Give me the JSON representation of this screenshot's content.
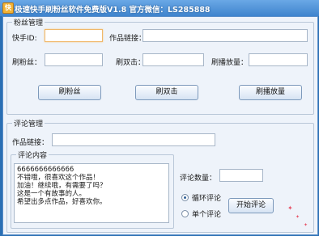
{
  "window": {
    "title": "极速快手刷粉丝软件免费版V1.8 官方微信：LS285888",
    "icon_glyph": "快"
  },
  "fans_group": {
    "label": "粉丝管理",
    "kuaishou_id_label": "快手ID:",
    "kuaishou_id_value": "",
    "work_link_label": "作品链接：",
    "work_link_value": "",
    "fans_label": "刷粉丝：",
    "fans_value": "",
    "double_click_label": "刷双击：",
    "double_click_value": "",
    "play_count_label": "刷播放量：",
    "play_count_value": "",
    "btn_fans": "刷粉丝",
    "btn_double_click": "刷双击",
    "btn_play_count": "刷播放量"
  },
  "comment_group": {
    "label": "评论管理",
    "work_link_label": "作品链接：",
    "work_link_value": "",
    "content_label": "评论内容",
    "content_text": "6666666666666\n不错哦，很喜欢这个作品！\n加油！继续哦，有需要了吗？\n这是一个有故事的人。\n希望出多点作品，好喜欢你。",
    "comment_count_label": "评论数量：",
    "comment_count_value": "",
    "loop_comment_label": "循环评论",
    "single_comment_label": "单个评论",
    "start_button": "开始评论"
  },
  "colors": {
    "title_bar": "#3f84cd",
    "client_bg": "#eef3fa",
    "focus_border": "#f0b86a"
  }
}
